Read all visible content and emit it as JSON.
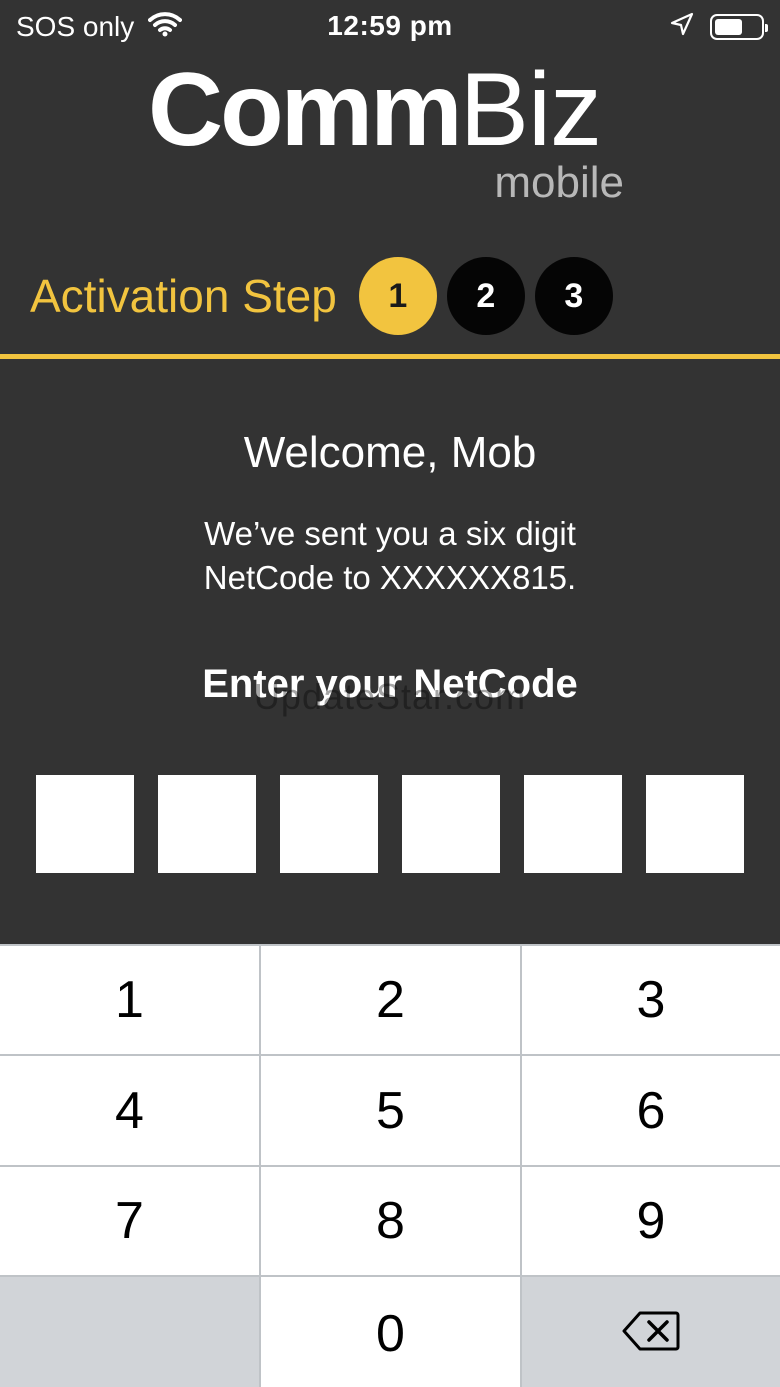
{
  "status_bar": {
    "carrier": "SOS only",
    "time": "12:59 pm"
  },
  "logo": {
    "brand_bold": "Comm",
    "brand_regular": "Biz",
    "subtitle": "mobile"
  },
  "activation": {
    "label": "Activation Step",
    "steps": [
      "1",
      "2",
      "3"
    ],
    "current_step": "1"
  },
  "content": {
    "welcome": "Welcome, Mob",
    "message": "We’ve sent you a six digit NetCode to XXXXXX815.",
    "enter_label": "Enter your NetCode",
    "watermark": "UpdateStar.com"
  },
  "code_input": {
    "digits": [
      "",
      "",
      "",
      "",
      "",
      ""
    ]
  },
  "keypad": {
    "keys": [
      "1",
      "2",
      "3",
      "4",
      "5",
      "6",
      "7",
      "8",
      "9",
      "",
      "0",
      "backspace"
    ]
  },
  "colors": {
    "accent": "#f2c43f",
    "background": "#333333"
  },
  "icons": {
    "wifi": "wifi-icon",
    "location": "location-arrow-icon",
    "battery": "battery-icon",
    "backspace": "backspace-icon"
  }
}
